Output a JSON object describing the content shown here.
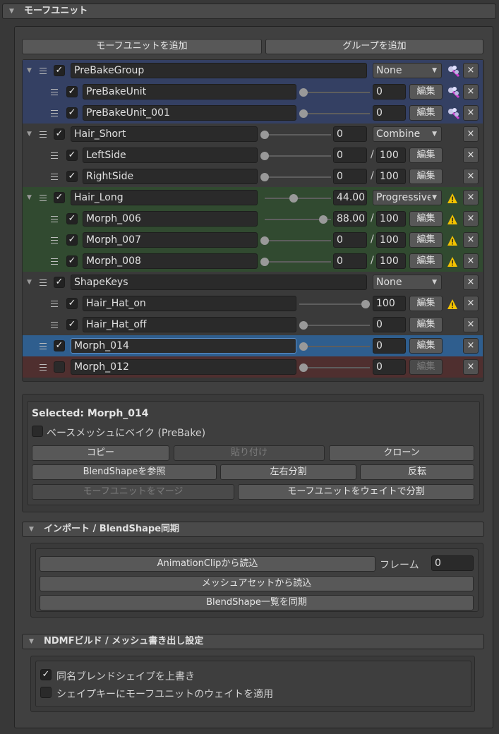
{
  "header": {
    "title": "モーフユニット"
  },
  "top_buttons": {
    "add_unit": "モーフユニットを追加",
    "add_group": "グループを追加"
  },
  "rows": {
    "r0": {
      "name": "PreBakeGroup",
      "mode": "None"
    },
    "r1": {
      "name": "PreBakeUnit",
      "value": "0",
      "edit": "編集"
    },
    "r2": {
      "name": "PreBakeUnit_001",
      "value": "0",
      "edit": "編集"
    },
    "r3": {
      "name": "Hair_Short",
      "value": "0",
      "mode": "Combine"
    },
    "r4": {
      "name": "LeftSide",
      "value": "0",
      "max": "100",
      "edit": "編集"
    },
    "r5": {
      "name": "RightSide",
      "value": "0",
      "max": "100",
      "edit": "編集"
    },
    "r6": {
      "name": "Hair_Long",
      "value": "44.00",
      "mode": "Progressive"
    },
    "r7": {
      "name": "Morph_006",
      "value": "88.00",
      "max": "100",
      "edit": "編集"
    },
    "r8": {
      "name": "Morph_007",
      "value": "0",
      "max": "100",
      "edit": "編集"
    },
    "r9": {
      "name": "Morph_008",
      "value": "0",
      "max": "100",
      "edit": "編集"
    },
    "r10": {
      "name": "ShapeKeys",
      "mode": "None"
    },
    "r11": {
      "name": "Hair_Hat_on",
      "value": "100",
      "edit": "編集"
    },
    "r12": {
      "name": "Hair_Hat_off",
      "value": "0",
      "edit": "編集"
    },
    "r13": {
      "name": "Morph_014",
      "value": "0",
      "edit": "編集"
    },
    "r14": {
      "name": "Morph_012",
      "value": "0",
      "edit": "編集"
    }
  },
  "close_glyph": "×",
  "check_glyph": "✓",
  "selected": {
    "title": "Selected: Morph_014",
    "prebake_label": "ベースメッシュにベイク (PreBake)",
    "copy": "コピー",
    "paste": "貼り付け",
    "clone": "クローン",
    "ref_blendshape": "BlendShapeを参照",
    "split_lr": "左右分割",
    "flip": "反転",
    "merge": "モーフユニットをマージ",
    "split_weight": "モーフユニットをウェイトで分割"
  },
  "import_section": {
    "title": "インポート / BlendShape同期",
    "from_clip": "AnimationClipから読込",
    "frame_label": "フレーム",
    "frame_value": "0",
    "from_meshset": "メッシュアセットから読込",
    "sync_list": "BlendShape一覧を同期"
  },
  "ndmf_section": {
    "title": "NDMFビルド / メッシュ書き出し設定",
    "overwrite_label": "同名ブレンドシェイプを上書き",
    "apply_weight_label": "シェイプキーにモーフユニットのウェイトを適用"
  },
  "colors": {
    "group_blue": "#344063",
    "group_green": "#314a30",
    "selected_row": "#2f5e8e",
    "disabled_row": "#4f2f2f",
    "warning": "#f2c200",
    "pin": "#d0d0ff"
  }
}
